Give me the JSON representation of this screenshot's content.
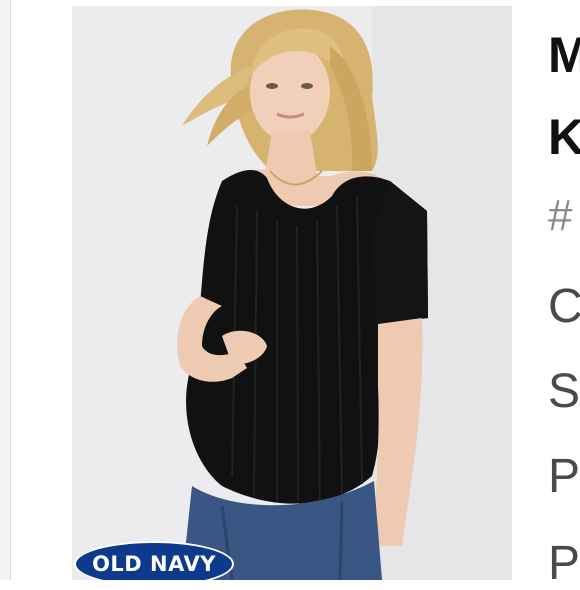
{
  "colors": {
    "background": "#ffffff",
    "photo_backdrop": "#ebebed",
    "badge_blue": "#0d3a8c",
    "shirt": "#111111",
    "hair": "#d9b774",
    "jeans": "#3a5684"
  },
  "brand_badge": {
    "text": "OLD NAVY"
  },
  "product_title": {
    "line1": "M",
    "line2": "K"
  },
  "details": {
    "sku": "#",
    "line1": "C",
    "line2": "S",
    "line3": "P",
    "line4": "P"
  },
  "product_image": {
    "icon": "model-photo"
  }
}
